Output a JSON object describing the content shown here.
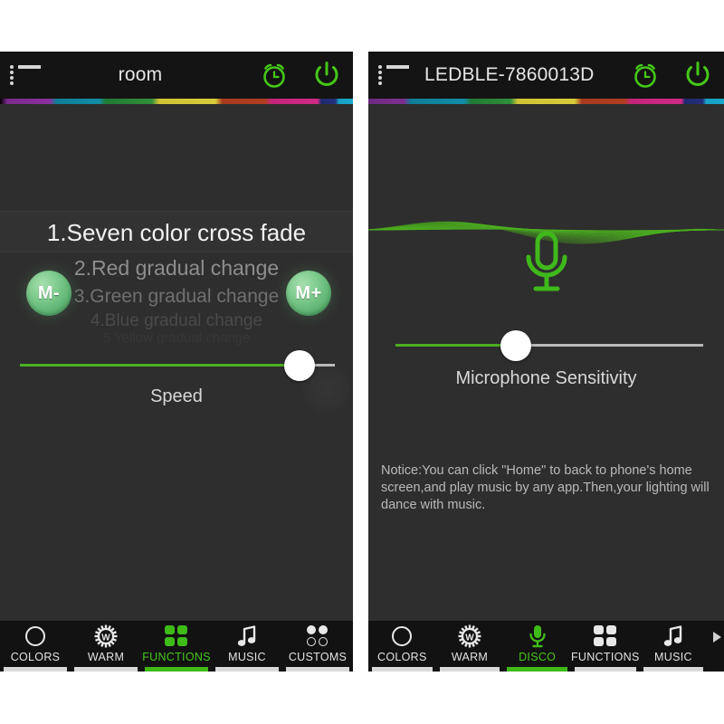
{
  "colors": {
    "accent_green": "#44c718",
    "mic_green": "#4caf20",
    "panel_bg": "#2e2e2e",
    "header_bg": "#141414",
    "tabbar_bg": "#121212",
    "selected_text": "#f2f2f2"
  },
  "left_panel": {
    "header": {
      "menu_icon": "hamburger-list-icon",
      "title": "room",
      "alarm_icon": "alarm-clock-icon",
      "power_icon": "power-icon"
    },
    "function_picker": {
      "selected_index": 1,
      "items": [
        "1.Seven color cross fade",
        "2.Red  gradual change",
        "3.Green gradual change",
        "4.Blue gradual change",
        "5.Yellow gradual change"
      ]
    },
    "mode_minus_label": "M-",
    "mode_plus_label": "M+",
    "speed_slider": {
      "label": "Speed",
      "value_percent": 93
    },
    "tabs": [
      {
        "label": "COLORS",
        "icon": "circle-outline-icon",
        "active": false
      },
      {
        "label": "WARM",
        "icon": "sun-w-icon",
        "active": false
      },
      {
        "label": "FUNCTIONS",
        "icon": "four-dots-icon",
        "active": true
      },
      {
        "label": "MUSIC",
        "icon": "music-note-icon",
        "active": false
      },
      {
        "label": "CUSTOMS",
        "icon": "four-circles-icon",
        "active": false
      }
    ]
  },
  "right_panel": {
    "header": {
      "menu_icon": "hamburger-list-icon",
      "title": "LEDBLE-7860013D",
      "alarm_icon": "alarm-clock-icon",
      "power_icon": "power-icon"
    },
    "waveform": {
      "icon": "green-sine-wave-visualizer",
      "color": "#4caf20"
    },
    "microphone_icon": "microphone-icon",
    "mic_slider": {
      "label": "Microphone Sensitivity",
      "value_percent": 38
    },
    "notice": "Notice:You can click \"Home\" to back to phone's home screen,and play music by any app.Then,your lighting will dance with music.",
    "tabs": [
      {
        "label": "COLORS",
        "icon": "circle-outline-icon",
        "active": false
      },
      {
        "label": "WARM",
        "icon": "sun-w-icon",
        "active": false
      },
      {
        "label": "DISCO",
        "icon": "microphone-icon",
        "active": true
      },
      {
        "label": "FUNCTIONS",
        "icon": "four-dots-icon",
        "active": false
      },
      {
        "label": "MUSIC",
        "icon": "music-note-icon",
        "active": false
      }
    ],
    "tab_overflow_icon": "right-arrow-icon"
  }
}
